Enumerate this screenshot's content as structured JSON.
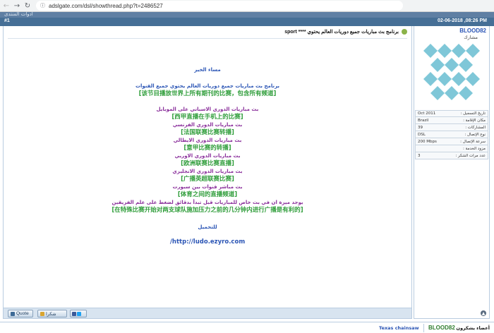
{
  "browser": {
    "url": "adslgate.com/dsl/showthread.php?t=2486527"
  },
  "forum": {
    "breadcrumb": "أدوات المنتدى",
    "post_date": "02-06-2018 ,08:26 PM",
    "post_number": "#1"
  },
  "post": {
    "title": "برنامج بث مباريات جميع دوريات العالم يحتوي **** sport",
    "lines": [
      {
        "style": "greet",
        "text": "مساء الخير"
      },
      {
        "style": "blue",
        "text": "برنامج بث مباريات جميع دوريات العالم يحتوي جميع القنوات"
      },
      {
        "style": "green",
        "text": "[该节目播放世界上所有期刊的比赛，包含所有频道]"
      },
      {
        "style": "gap",
        "text": ""
      },
      {
        "style": "purple",
        "text": "بث مباريات الدوري الاسباني على الموبايل"
      },
      {
        "style": "green-cn",
        "text": "[西甲直播在手机上的比赛]"
      },
      {
        "style": "purple",
        "text": "بث مباريات الدوري الفرنسي"
      },
      {
        "style": "green-cn",
        "text": "[法国联赛比赛转播]"
      },
      {
        "style": "purple",
        "text": "بث مباريات الدوري الايطالي"
      },
      {
        "style": "green-cn",
        "text": "[意甲比赛的转播]"
      },
      {
        "style": "purple",
        "text": "بث مباريات الدوري الاوربي"
      },
      {
        "style": "green-cn",
        "text": "[欧洲联赛比赛直播]"
      },
      {
        "style": "purple",
        "text": "بث مباريات الدوري الانجليزي"
      },
      {
        "style": "green-cn",
        "text": "[广播英超联赛比赛]"
      },
      {
        "style": "purple",
        "text": "بث مباشر قنوات بين سبورت"
      },
      {
        "style": "green-cn",
        "text": "[体育之间的直播频道]"
      },
      {
        "style": "purple",
        "text": "يوجد ميزة ان في بث خاص للمباريات قبل تبدأ بدقائق لضغط على علم الفريقين"
      },
      {
        "style": "green-cn",
        "text": "[在特殊比赛开始对两支球队施加压力之前的几分钟内进行广播是有利的]"
      },
      {
        "style": "dl",
        "text": "للتحميل"
      },
      {
        "style": "link",
        "text": "/http://ludo.ezyro.com"
      }
    ]
  },
  "buttons": {
    "quote": "Quote",
    "thanks": "شكرا"
  },
  "user": {
    "name": "BLOOD82",
    "rank": "مشارك",
    "info": [
      {
        "label": "تاريخ التسجيل :",
        "value": "Oct 2011"
      },
      {
        "label": "مكان الإقامة :",
        "value": "Brazil"
      },
      {
        "label": "المشاركات :",
        "value": "39"
      },
      {
        "label": "نوع الإتصال :",
        "value": "DSL"
      },
      {
        "label": "سرعة الإتصال :",
        "value": "200 Mbps"
      },
      {
        "label": "مزود الخدمة :",
        "value": ""
      },
      {
        "label": "عدد مرات الشكر :",
        "value": "3"
      }
    ]
  },
  "thanks_bar": {
    "label": "أعضاء يشكرون",
    "name": "BLOOD82",
    "thanker": "Texas chainsaw"
  },
  "colors": {
    "header": "#466f96",
    "accent_blue": "#2b55b5",
    "accent_green": "#2f9d3a",
    "accent_purple": "#8a2f9b",
    "avatar_blue": "#7fc7d8"
  },
  "icons": [
    "back-icon",
    "forward-icon",
    "reload-icon",
    "lock-icon",
    "topic-icon",
    "quote-icon",
    "thumbs-up-icon",
    "facebook-icon",
    "twitter-icon",
    "share-icon",
    "scroll-icon"
  ]
}
